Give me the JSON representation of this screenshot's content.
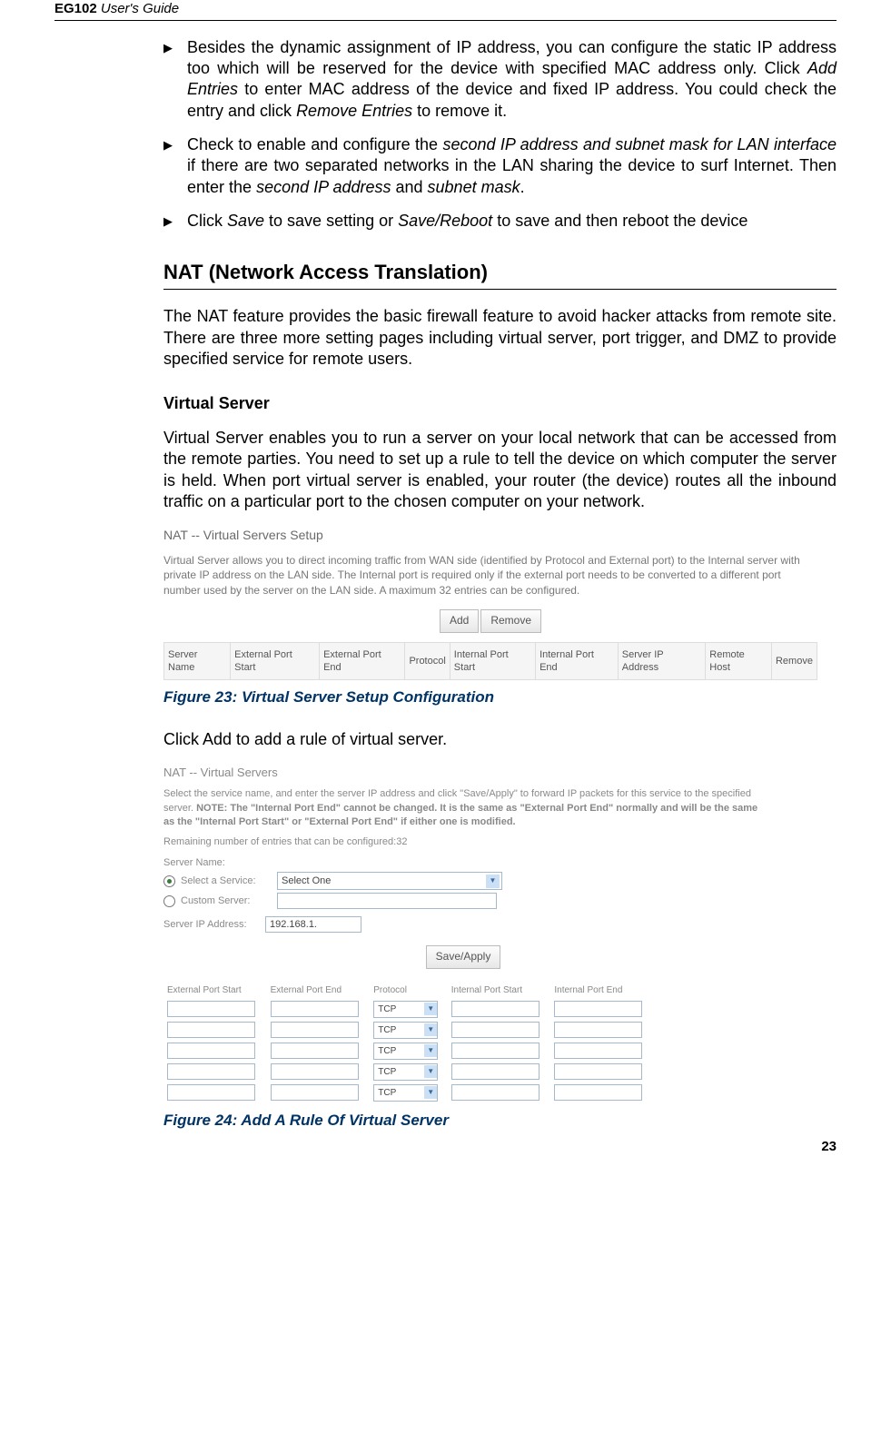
{
  "header": {
    "model": "EG102",
    "guide": " User's Guide"
  },
  "bullets": [
    {
      "pre": "Besides the dynamic assignment of IP address, you can configure the static IP address too which will be reserved for the device with specified MAC address only. Click ",
      "i1": "Add Entries",
      "mid1": " to enter MAC address of the device and fixed IP address. You could check the entry and click ",
      "i2": "Remove Entries",
      "post": " to remove it."
    },
    {
      "pre": "Check to enable and configure the ",
      "i1": "second IP address and subnet mask for LAN interface",
      "mid1": " if there are two separated networks in the LAN sharing the device to surf Internet. Then enter the ",
      "i2": "second IP address",
      "mid2": " and ",
      "i3": "subnet mask",
      "post": "."
    },
    {
      "pre": "Click ",
      "i1": "Save",
      "mid1": " to save setting or ",
      "i2": "Save/Reboot",
      "post": " to save and then reboot the device"
    }
  ],
  "nat": {
    "title": "NAT (Network Access Translation)",
    "para": "The NAT feature provides the basic firewall feature to avoid hacker attacks from remote site. There are three more setting pages including virtual server, port trigger, and DMZ to provide specified service for remote users."
  },
  "vs": {
    "head": "Virtual Server",
    "para": "Virtual Server enables you to run a server on your local network that can be accessed from the remote parties. You need to set up a rule to tell the device on which computer the server is held. When port virtual server is enabled, your router (the device) routes all the inbound traffic on a particular port to the chosen computer on your network."
  },
  "shot1": {
    "title": "NAT -- Virtual Servers Setup",
    "desc": "Virtual Server allows you to direct incoming traffic from WAN side (identified by Protocol and External port) to the Internal server with private IP address on the LAN side. The Internal port is required only if the external port needs to be converted to a different port number used by the server on the LAN side. A maximum 32 entries can be configured.",
    "add": "Add",
    "remove": "Remove",
    "cols": [
      "Server Name",
      "External Port Start",
      "External Port End",
      "Protocol",
      "Internal Port Start",
      "Internal Port End",
      "Server IP Address",
      "Remote Host",
      "Remove"
    ]
  },
  "fig23": "Figure 23: Virtual Server Setup Configuration",
  "addline": "Click Add to add a rule of virtual server.",
  "shot2": {
    "title": "NAT -- Virtual Servers",
    "desc1": "Select the service name, and enter the server IP address and click \"Save/Apply\" to forward IP packets for this service to the specified server. ",
    "descbold": "NOTE: The \"Internal Port End\" cannot be changed. It is the same as \"External Port End\" normally and will be the same as the \"Internal Port Start\" or \"External Port End\" if either one is modified.",
    "remain": "Remaining number of entries that can be configured:32",
    "servername": "Server Name:",
    "selservice": "Select a Service:",
    "selval": "Select One",
    "custom": "Custom Server:",
    "ipaddr": "Server IP Address:",
    "ipval": "192.168.1.",
    "saveapply": "Save/Apply",
    "cols": [
      "External Port Start",
      "External Port End",
      "Protocol",
      "Internal Port Start",
      "Internal Port End"
    ],
    "proto": "TCP"
  },
  "fig24": "Figure 24: Add A Rule Of Virtual Server",
  "pagenum": "23"
}
